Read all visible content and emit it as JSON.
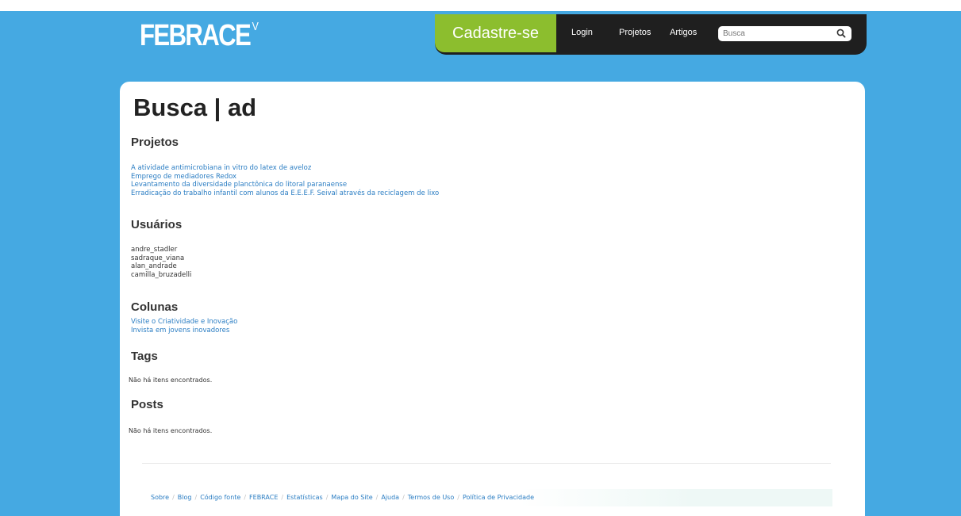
{
  "header": {
    "logo_text": "FEBRACE",
    "logo_superscript": "V",
    "signup_label": "Cadastre-se",
    "nav": [
      "Login",
      "Projetos",
      "Artigos"
    ],
    "search_placeholder": "Busca"
  },
  "page": {
    "title": "Busca | ad",
    "sections": {
      "projetos": {
        "title": "Projetos",
        "items": [
          "A atividade antimicrobiana in vitro do latex de aveloz",
          "Emprego de mediadores Redox",
          "Levantamento da diversidade planctônica do litoral paranaense",
          "Erradicação do trabalho infantil com alunos da E.E.E.F. Seival através da reciclagem de lixo"
        ]
      },
      "usuarios": {
        "title": "Usuários",
        "items": [
          "andre_stadler",
          "sadraque_viana",
          "alan_andrade",
          "camilla_bruzadelli"
        ]
      },
      "colunas": {
        "title": "Colunas",
        "items": [
          "Visite o Criatividade e Inovação",
          "Invista em jovens inovadores"
        ]
      },
      "tags": {
        "title": "Tags",
        "empty": "Não há itens encontrados."
      },
      "posts": {
        "title": "Posts",
        "empty": "Não há itens encontrados."
      }
    }
  },
  "footer": {
    "links": [
      "Sobre",
      "Blog",
      "Código fonte",
      "FEBRACE",
      "Estatísticas",
      "Mapa do Site",
      "Ajuda",
      "Termos de Uso",
      "Política de Privacidade"
    ]
  },
  "colors": {
    "background": "#45a9e2",
    "accent_green": "#8cbe2e",
    "nav_dark": "#1f1f1f",
    "link_blue": "#2a7dc3"
  },
  "icons": {
    "search": "magnifier-icon"
  }
}
